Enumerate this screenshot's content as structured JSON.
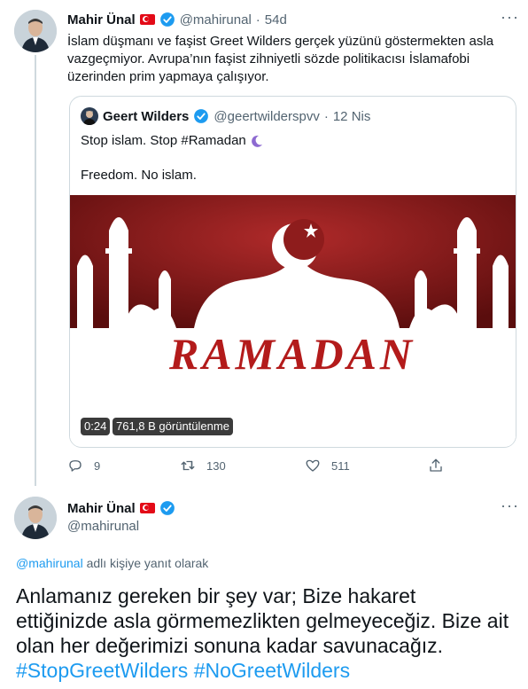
{
  "reply_context": {
    "author_name": "Mahir Ünal",
    "handle": "@mahirunal",
    "separator": "·",
    "time": "54d",
    "text": "İslam düşmanı ve faşist Greet Wilders gerçek yüzünü göstermekten asla vazgeçmiyor. Avrupa’nın faşist zihniyetli sözde politikacısı İslamafobi üzerinden prim yapmaya çalışıyor.",
    "more": "···"
  },
  "quoted_tweet": {
    "author_name": "Geert Wilders",
    "handle": "@geertwilderspvv",
    "separator": "·",
    "time": "12 Nis",
    "line1": "Stop islam. Stop #Ramadan",
    "line2": "Freedom. No islam.",
    "media_word": "RAMADAN",
    "video_duration": "0:24",
    "views": "761,8 B görüntülenme"
  },
  "actions": {
    "reply_count": "9",
    "retweet_count": "130",
    "like_count": "511"
  },
  "main_tweet": {
    "author_name": "Mahir Ünal",
    "handle": "@mahirunal",
    "more": "···",
    "reply_to_handle": "@mahirunal",
    "reply_to_suffix": " adlı kişiye yanıt olarak",
    "text": "Anlamanız gereken bir şey var; Bize hakaret ettiğinizde asla görmemezlikten gelmeyeceğiz. Bize ait olan her değerimizi sonuna kadar savunacağız.",
    "hashtag1": "#StopGreetWilders",
    "hashtag2": "#NoGreetWilders"
  },
  "colors": {
    "accent": "#1d9bf0",
    "media_red": "#9b1b1b",
    "muted": "#536471"
  }
}
